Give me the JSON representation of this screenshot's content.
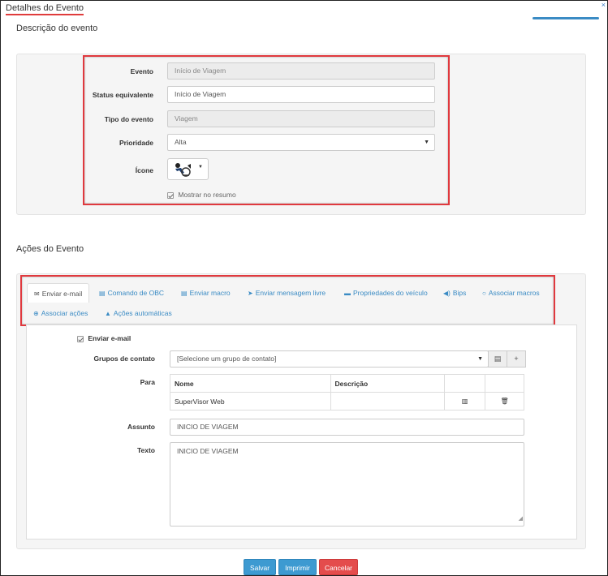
{
  "header": {
    "title": "Detalhes do Evento",
    "close_label": "×"
  },
  "description_section": {
    "title": "Descrição do evento",
    "fields": {
      "evento": {
        "label": "Evento",
        "value": "Início de Viagem"
      },
      "status": {
        "label": "Status equivalente",
        "value": "Início de Viagem"
      },
      "tipo": {
        "label": "Tipo do evento",
        "value": "Viagem"
      },
      "prioridade": {
        "label": "Prioridade",
        "value": "Alta"
      },
      "icone": {
        "label": "Ícone",
        "icon": "driver-wheel-icon"
      },
      "mostrar": {
        "label": "Mostrar no resumo",
        "checked": true
      }
    }
  },
  "actions_section": {
    "title": "Ações do Evento",
    "tabs": [
      {
        "label": "Enviar e-mail",
        "icon": "envelope-icon",
        "glyph": "✉"
      },
      {
        "label": "Comando de OBC",
        "icon": "keyboard-icon",
        "glyph": "▤"
      },
      {
        "label": "Enviar macro",
        "icon": "list-icon",
        "glyph": "▤"
      },
      {
        "label": "Enviar mensagem livre",
        "icon": "send-icon",
        "glyph": "➤"
      },
      {
        "label": "Propriedades do veículo",
        "icon": "truck-icon",
        "glyph": "▬"
      },
      {
        "label": "Bips",
        "icon": "volume-icon",
        "glyph": "◀)"
      },
      {
        "label": "Associar macros",
        "icon": "circle-icon",
        "glyph": "○"
      },
      {
        "label": "Associar ações",
        "icon": "plus-circle-icon",
        "glyph": "⊕"
      },
      {
        "label": "Ações automáticas",
        "icon": "warning-icon",
        "glyph": "▲"
      }
    ],
    "email": {
      "enable_label": "Enviar e-mail",
      "groups_label": "Grupos de contato",
      "groups_value": "[Selecione um grupo de contato]",
      "para_label": "Para",
      "table": {
        "headers": [
          "Nome",
          "Descrição"
        ],
        "rows": [
          {
            "name": "SuperVisor Web",
            "description": ""
          }
        ]
      },
      "assunto_label": "Assunto",
      "assunto_value": "INICIO DE VIAGEM",
      "texto_label": "Texto",
      "texto_value": "INICIO DE VIAGEM"
    }
  },
  "buttons": {
    "save": "Salvar",
    "print": "Imprimir",
    "cancel": "Cancelar"
  },
  "colors": {
    "accent": "#3d9ad1",
    "danger": "#e44c4c",
    "highlight": "#e0393e"
  }
}
